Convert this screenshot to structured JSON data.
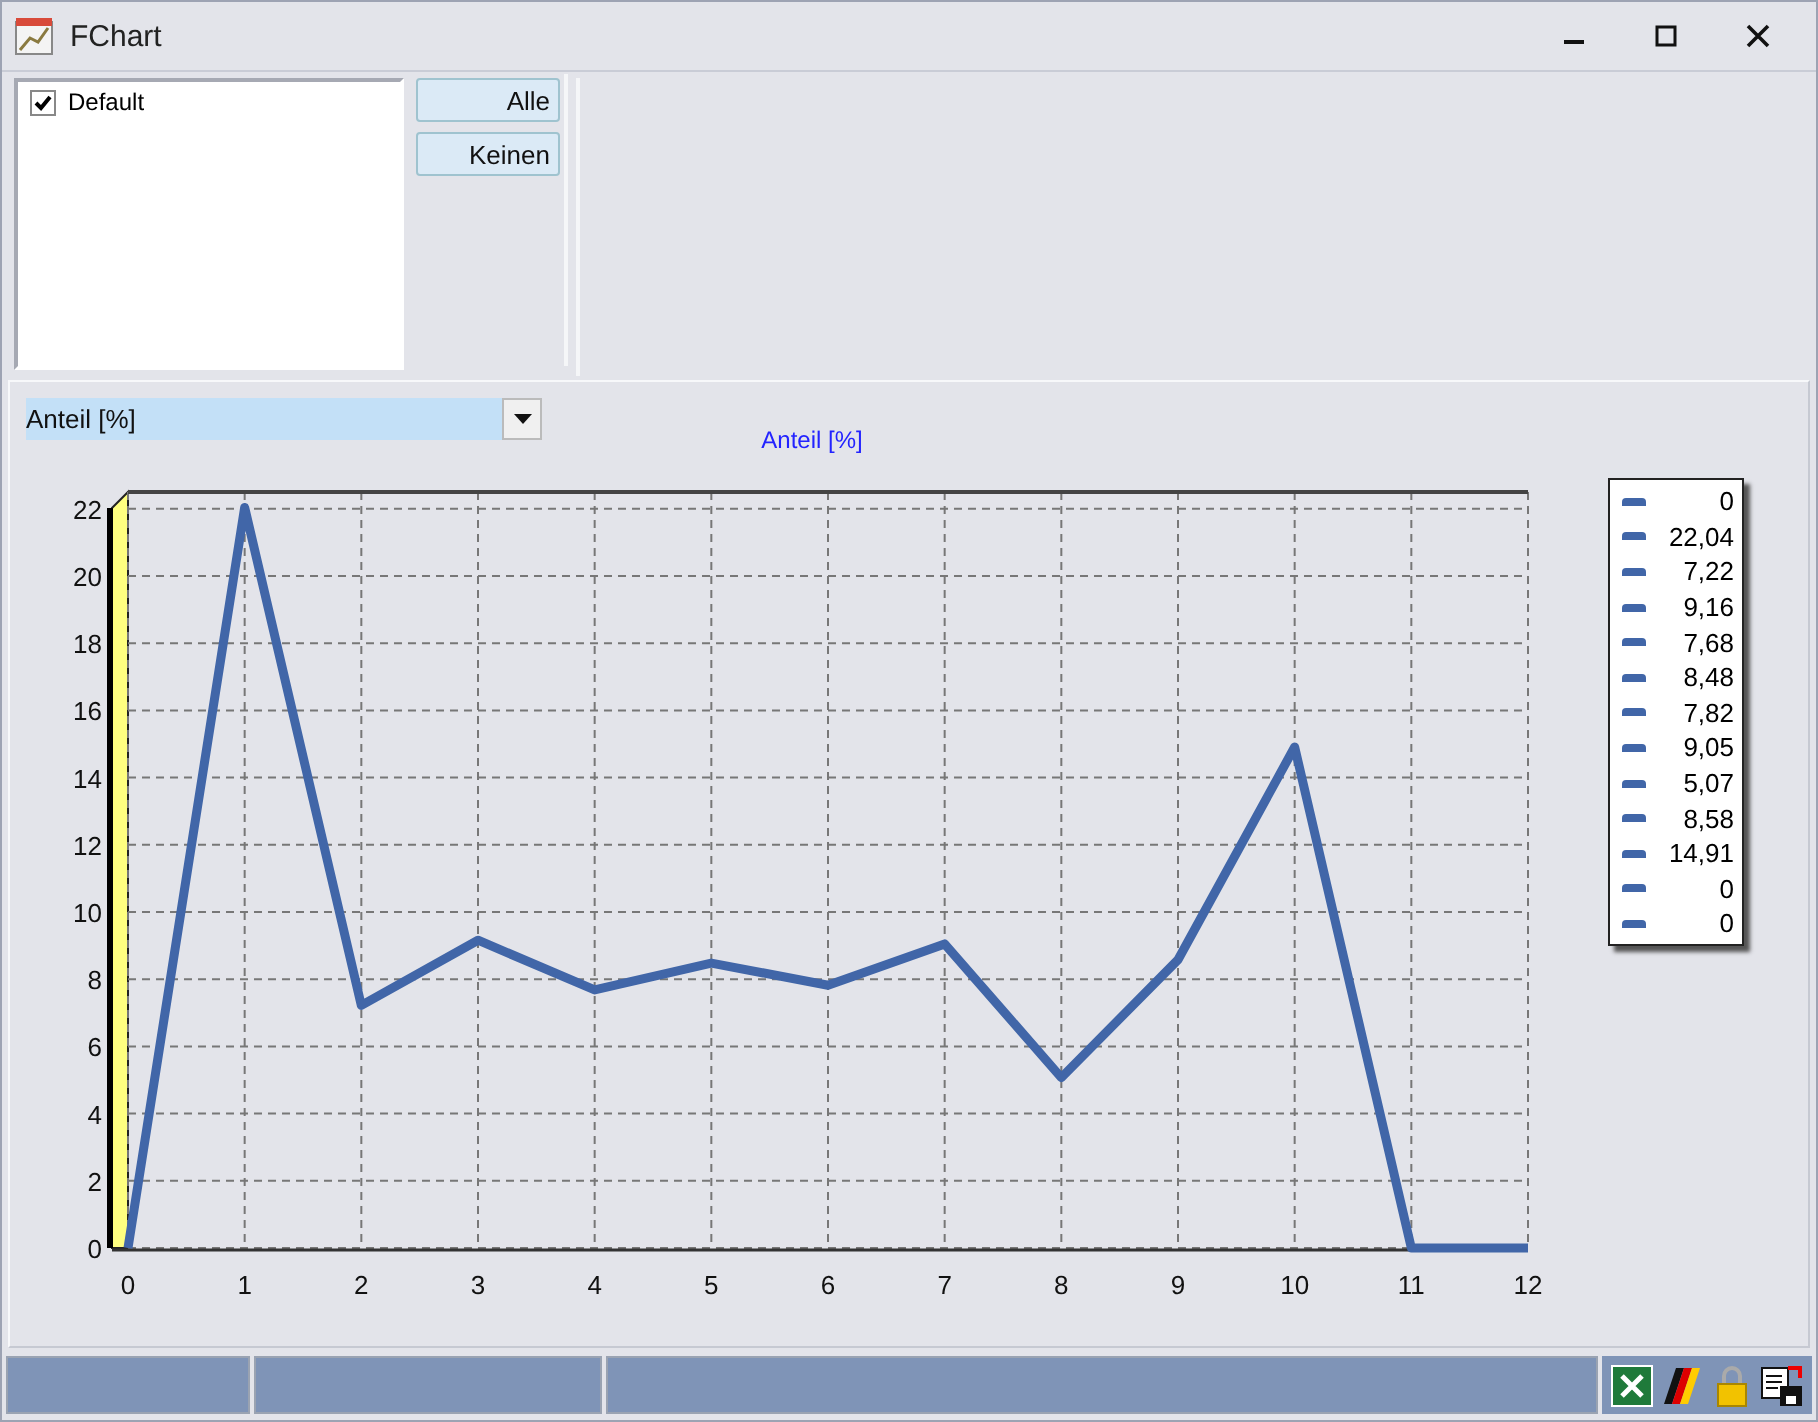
{
  "window": {
    "title": "FChart"
  },
  "series_list": {
    "items": [
      {
        "label": "Default",
        "checked": true
      }
    ]
  },
  "buttons": [
    "Alle",
    "Keinen"
  ],
  "chart": {
    "selector": {
      "value": "Anteil [%]"
    },
    "legend": [
      "0",
      "22,04",
      "7,22",
      "9,16",
      "7,68",
      "8,48",
      "7,82",
      "9,05",
      "5,07",
      "8,58",
      "14,91",
      "0",
      "0"
    ],
    "chart_data": {
      "type": "line",
      "title": "Anteil [%]",
      "x": [
        0,
        1,
        2,
        3,
        4,
        5,
        6,
        7,
        8,
        9,
        10,
        11,
        12
      ],
      "series": [
        {
          "color": "#4166a8",
          "values": [
            0,
            22.04,
            7.22,
            9.16,
            7.68,
            8.48,
            7.82,
            9.05,
            5.07,
            8.58,
            14.91,
            0,
            0
          ]
        }
      ],
      "xlim": [
        0,
        12
      ],
      "ylim": [
        0,
        22.5
      ],
      "grid": true,
      "xticks": [
        0,
        1,
        2,
        3,
        4,
        5,
        6,
        7,
        8,
        9,
        10,
        11,
        12
      ],
      "yticks": [
        0,
        2,
        4,
        6,
        8,
        10,
        12,
        14,
        16,
        18,
        20,
        22
      ]
    }
  }
}
